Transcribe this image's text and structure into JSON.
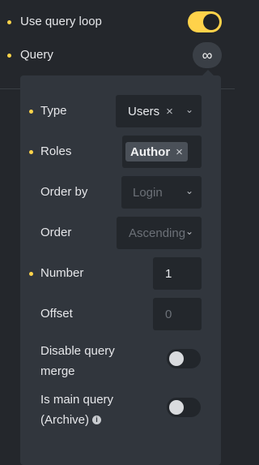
{
  "header": {
    "use_query_loop_label": "Use query loop",
    "query_label": "Query",
    "loop_icon_glyph": "∞",
    "accent_color": "#ffd24a"
  },
  "panel": {
    "type": {
      "label": "Type",
      "value": "Users",
      "clear_glyph": "×",
      "chevron_glyph": "⌄"
    },
    "roles": {
      "label": "Roles",
      "tag": "Author",
      "remove_glyph": "×"
    },
    "order_by": {
      "label": "Order by",
      "placeholder": "Login",
      "chevron_glyph": "⌄"
    },
    "order": {
      "label": "Order",
      "placeholder": "Ascending",
      "chevron_glyph": "⌄"
    },
    "number": {
      "label": "Number",
      "value": "1"
    },
    "offset": {
      "label": "Offset",
      "placeholder": "0"
    },
    "disable_query_merge": {
      "label_line1": "Disable query",
      "label_line2": "merge",
      "enabled": false
    },
    "is_main_query": {
      "label_line1": "Is main query",
      "label_line2": "(Archive)",
      "info_glyph": "i",
      "enabled": false
    }
  }
}
